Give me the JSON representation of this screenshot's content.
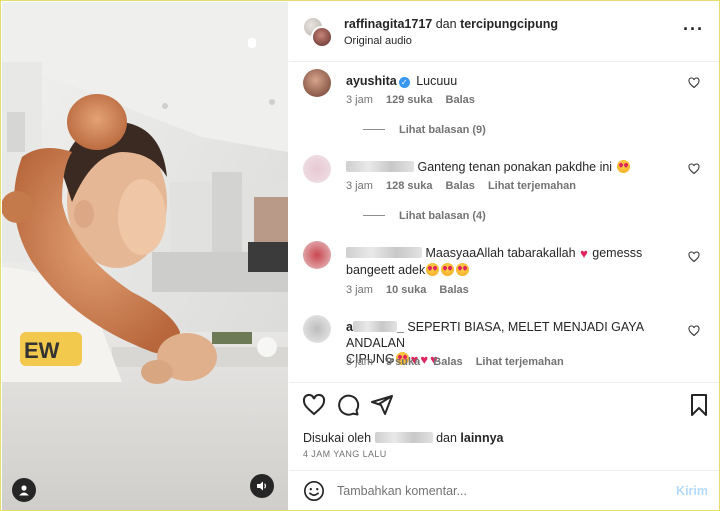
{
  "header": {
    "user1": "raffinagita1717",
    "joiner": "dan",
    "user2": "tercipungcipung",
    "subtitle": "Original audio"
  },
  "comments": [
    {
      "username": "ayushita",
      "verified": true,
      "text": "Lucuuu",
      "time": "3 jam",
      "likes": "129 suka",
      "reply": "Balas",
      "translate": "",
      "view_replies": "Lihat balasan (9)"
    },
    {
      "username": "",
      "text": "Ganteng tenan ponakan pakdhe ini",
      "time": "3 jam",
      "likes": "128 suka",
      "reply": "Balas",
      "translate": "Lihat terjemahan",
      "view_replies": "Lihat balasan (4)"
    },
    {
      "username": "",
      "text": "MaasyaaAllah tabarakallah",
      "text2": "gemesss",
      "text3": "bangeett adek",
      "time": "3 jam",
      "likes": "10 suka",
      "reply": "Balas",
      "translate": ""
    },
    {
      "username_prefix": "a",
      "username_suffix": "_",
      "text": "SEPERTI BIASA, MELET MENJADI GAYA ANDALAN",
      "text2": "CIPUNG",
      "time": "3 jam",
      "likes": "9 suka",
      "reply": "Balas",
      "translate": "Lihat terjemahan"
    }
  ],
  "actions": {
    "liked_prefix": "Disukai oleh",
    "liked_joiner": "dan",
    "liked_others": "lainnya",
    "time_ago": "4 JAM YANG LALU"
  },
  "compose": {
    "placeholder": "Tambahkan komentar...",
    "post_label": "Kirim"
  },
  "icons": {
    "more": "more-horizontal-icon",
    "like": "heart-icon",
    "comment": "comment-icon",
    "share": "send-icon",
    "save": "bookmark-icon",
    "emoji": "emoji-icon",
    "user_tag": "user-tag-icon",
    "audio": "speaker-icon"
  },
  "colors": {
    "link": "#0095f6",
    "post_disabled": "#b3dbff",
    "heart": "#e0245e",
    "verified": "#3897f0"
  }
}
